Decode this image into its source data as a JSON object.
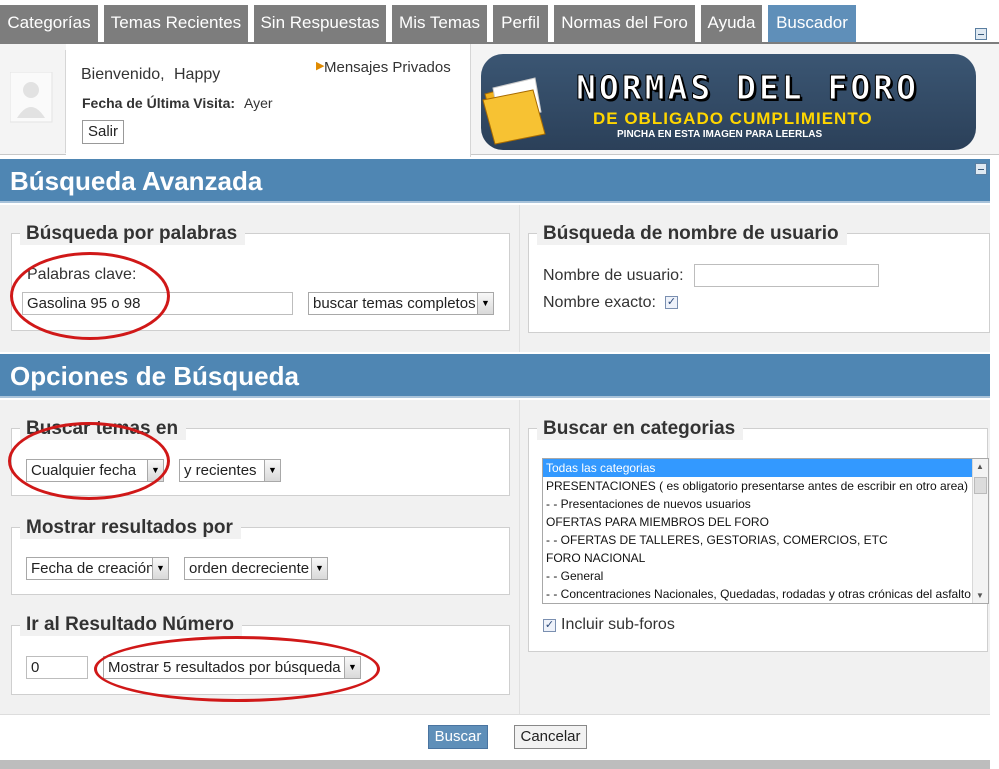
{
  "tabs": [
    "Categorías",
    "Temas Recientes",
    "Sin Respuestas",
    "Mis Temas",
    "Perfil",
    "Normas del Foro",
    "Ayuda",
    "Buscador"
  ],
  "header": {
    "welcome": "Bienvenido,",
    "username": "Happy",
    "last_visit_label": "Fecha de Última Visita:",
    "last_visit_value": "Ayer",
    "logout": "Salir",
    "private_messages": "Mensajes Privados"
  },
  "banner": {
    "line1": "NORMAS DEL FORO",
    "line2": "DE OBLIGADO CUMPLIMIENTO",
    "line3": "PINCHA EN ESTA IMAGEN PARA LEERLAS"
  },
  "advanced": {
    "title": "Búsqueda Avanzada",
    "words_legend": "Búsqueda por palabras",
    "keywords_label": "Palabras clave:",
    "keywords_value": "Gasolina 95 o 98",
    "search_mode": "buscar temas completos",
    "user_legend": "Búsqueda de nombre de usuario",
    "username_label": "Nombre de usuario:",
    "exact_label": "Nombre exacto:"
  },
  "options": {
    "title": "Opciones de Búsqueda",
    "topics_legend": "Buscar temas en",
    "date_select": "Cualquier fecha",
    "date_mode": "y recientes",
    "results_legend": "Mostrar resultados por",
    "sort_field": "Fecha de creación",
    "sort_order": "orden decreciente",
    "goto_legend": "Ir al Resultado Número",
    "goto_value": "0",
    "per_page": "Mostrar 5 resultados por búsqueda",
    "categories_legend": "Buscar en categorias",
    "categories": [
      "Todas las categorias",
      "PRESENTACIONES ( es obligatorio presentarse antes de escribir en otro area)",
      "- - Presentaciones de nuevos usuarios",
      "OFERTAS PARA MIEMBROS DEL FORO",
      "- - OFERTAS DE TALLERES, GESTORIAS, COMERCIOS, ETC",
      "FORO NACIONAL",
      "- - General",
      "- - Concentraciones Nacionales, Quedadas, rodadas y otras crónicas del asfalto"
    ],
    "include_subforums": "Incluir sub-foros"
  },
  "actions": {
    "search": "Buscar",
    "cancel": "Cancelar"
  },
  "colors": {
    "tab_bg": "#7d7d7d",
    "tab_active": "#5f8fb9",
    "section_bar": "#4f86b3",
    "annotation_ring": "#d01818"
  }
}
